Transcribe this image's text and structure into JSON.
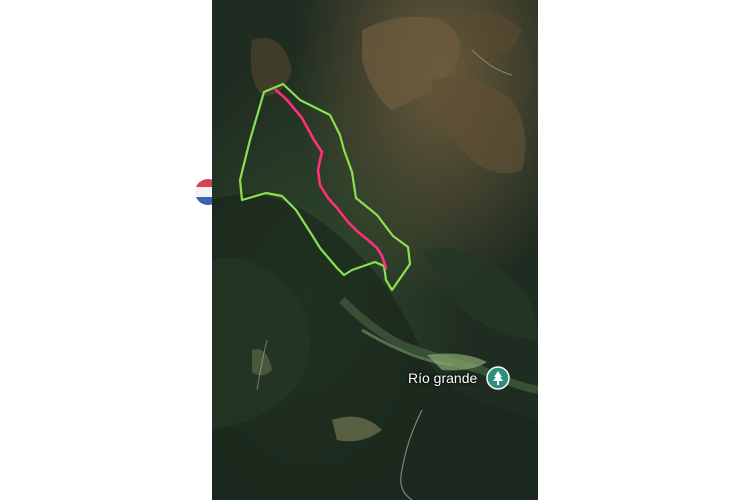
{
  "map": {
    "place_label": "Río grande",
    "place_icon": "tree-pin-icon",
    "boundary_color": "#8be04e",
    "route_color": "#ff2f7a",
    "pin_color": "#2f8f7e",
    "watermark_icon": "flag-badge-icon"
  }
}
